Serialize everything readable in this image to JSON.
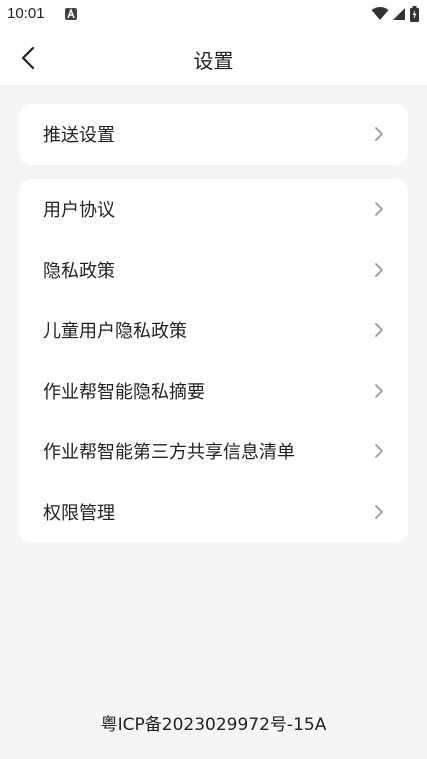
{
  "status_bar": {
    "time": "10:01",
    "icons": [
      "a-notification-icon",
      "wifi-icon",
      "signal-icon",
      "battery-icon"
    ]
  },
  "header": {
    "title": "设置",
    "back_icon": "chevron-left-icon"
  },
  "groups": [
    {
      "items": [
        {
          "label": "推送设置",
          "icon": "chevron-right-icon"
        }
      ]
    },
    {
      "items": [
        {
          "label": "用户协议",
          "icon": "chevron-right-icon"
        },
        {
          "label": "隐私政策",
          "icon": "chevron-right-icon"
        },
        {
          "label": "儿童用户隐私政策",
          "icon": "chevron-right-icon"
        },
        {
          "label": "作业帮智能隐私摘要",
          "icon": "chevron-right-icon"
        },
        {
          "label": "作业帮智能第三方共享信息清单",
          "icon": "chevron-right-icon"
        },
        {
          "label": "权限管理",
          "icon": "chevron-right-icon"
        }
      ]
    }
  ],
  "footer": {
    "icp": "粤ICP备2023029972号-15A"
  },
  "colors": {
    "background": "#f5f5f5",
    "card": "#ffffff",
    "text": "#222222",
    "chevron": "#999999"
  }
}
